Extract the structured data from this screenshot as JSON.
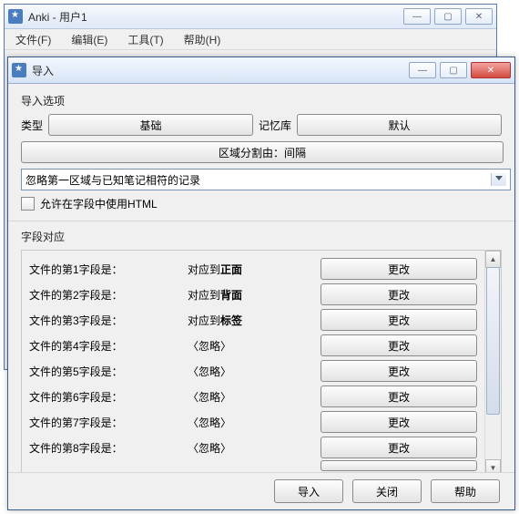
{
  "main": {
    "title": "Anki - 用户1",
    "menus": [
      "文件(F)",
      "编辑(E)",
      "工具(T)",
      "帮助(H)"
    ]
  },
  "import": {
    "title": "导入",
    "options_label": "导入选项",
    "type_label": "类型",
    "type_button": "基础",
    "deck_label": "记忆库",
    "deck_button": "默认",
    "delimiter_button": "区域分割由：间隔",
    "dedupe_select": "忽略第一区域与已知笔记相符的记录",
    "allow_html_label": "允许在字段中使用HTML",
    "mapping_label": "字段对应",
    "change_label": "更改",
    "rows": [
      {
        "file": "文件的第1字段是：",
        "map_prefix": "对应到",
        "map_bold": "正面"
      },
      {
        "file": "文件的第2字段是：",
        "map_prefix": "对应到",
        "map_bold": "背面"
      },
      {
        "file": "文件的第3字段是：",
        "map_prefix": "对应到",
        "map_bold": "标签"
      },
      {
        "file": "文件的第4字段是：",
        "map_plain": "〈忽略〉"
      },
      {
        "file": "文件的第5字段是：",
        "map_plain": "〈忽略〉"
      },
      {
        "file": "文件的第6字段是：",
        "map_plain": "〈忽略〉"
      },
      {
        "file": "文件的第7字段是：",
        "map_plain": "〈忽略〉"
      },
      {
        "file": "文件的第8字段是：",
        "map_plain": "〈忽略〉"
      }
    ],
    "footer": {
      "import": "导入",
      "close": "关闭",
      "help": "帮助"
    }
  }
}
